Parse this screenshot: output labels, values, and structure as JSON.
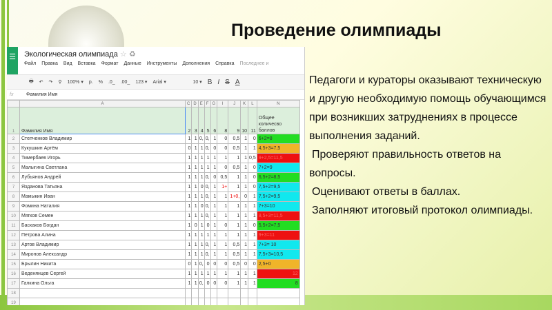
{
  "slide": {
    "title": "Проведение олимпиады",
    "paragraphs": [
      "Педагоги и кураторы оказывают техническую и другую необходимую помощь обучающимся при возникших затруднениях в процессе выполнения заданий.",
      "Проверяют правильность ответов на вопросы.",
      "Оценивают ответы в баллах.",
      "Заполняют итоговый протокол олимпиады."
    ]
  },
  "sheet": {
    "title": "Экологическая олимпиада",
    "menu": [
      "Файл",
      "Правка",
      "Вид",
      "Вставка",
      "Формат",
      "Данные",
      "Инструменты",
      "Дополнения",
      "Справка",
      "Последнее и"
    ],
    "toolbar": {
      "zoom": "100% ▾",
      "currency": "р.",
      "percent": "%",
      "dec1": ".0_",
      "dec2": ".00_",
      "format": "123 ▾",
      "font": "Arial ▾",
      "size": "10 ▾",
      "bold": "B",
      "italic": "I",
      "strike": "S",
      "color": "A"
    },
    "formula": {
      "fx": "fx",
      "value": "Фамилия Имя"
    },
    "columns": [
      "",
      "A",
      "C",
      "D",
      "E",
      "F",
      "G",
      "I",
      "J",
      "K",
      "L",
      "N"
    ],
    "header_row": [
      "1",
      "Фамилия Имя",
      "2",
      "3",
      "4",
      "5",
      "6",
      "8",
      "9",
      "10",
      "11",
      "Общее количесво баллов"
    ],
    "rows": [
      [
        "2",
        "Степченков Владимир",
        "1",
        "1",
        "0,",
        "0,",
        "1",
        "0",
        "0,5",
        "1",
        "0",
        "6+2=8",
        "#22dd22"
      ],
      [
        "3",
        "Кукушкин Артём",
        "0",
        "1",
        "1",
        "0,",
        "0",
        "0",
        "0,5",
        "1",
        "1",
        "4,5+3=7,5",
        "#f0b429"
      ],
      [
        "4",
        "Тимербаев Игорь",
        "1",
        "1",
        "1",
        "1",
        "1",
        "1",
        "1",
        "1",
        "0,5",
        "9+2,5=11,5",
        "#ee1111"
      ],
      [
        "5",
        "Малыгина Светлана",
        "1",
        "1",
        "1",
        "1",
        "1",
        "0",
        "0,5",
        "1",
        "0",
        "7+2=9",
        "#11e8ee"
      ],
      [
        "6",
        "Лубьянов Андрей",
        "1",
        "1",
        "1",
        "0,",
        "0",
        "0,5",
        "1",
        "1",
        "0",
        "6,5+2=8,5",
        "#22dd22"
      ],
      [
        "7",
        "Язданова Татьяна",
        "1",
        "1",
        "0",
        "0,",
        "1",
        "1+",
        "1",
        "1",
        "0",
        "7,5+2=9,5",
        "#11e8ee"
      ],
      [
        "8",
        "Мамыкин Иван",
        "1",
        "1",
        "1",
        "0,",
        "1",
        "1",
        "1+0,",
        "0",
        "1",
        "7,5+2=9,5",
        "#11e8ee"
      ],
      [
        "9",
        "Фомина Наталия",
        "1",
        "1",
        "0",
        "0,",
        "1",
        "1",
        "1",
        "1",
        "1",
        "7+3=10",
        "#11e8ee"
      ],
      [
        "10",
        "Мягков Семен",
        "1",
        "1",
        "1",
        "0,",
        "1",
        "1",
        "1",
        "1",
        "1",
        "8,5+3=11,5",
        "#ee1111"
      ],
      [
        "11",
        "Баскаков Богдан",
        "1",
        "0",
        "1",
        "0",
        "1",
        "0",
        "1",
        "1",
        "0",
        "5,5+2=7,5",
        "#22dd22"
      ],
      [
        "12",
        "Петрова Алина",
        "1",
        "1",
        "1",
        "1",
        "1",
        "1",
        "1",
        "1",
        "1",
        "9+3=11",
        "#ee1111"
      ],
      [
        "13",
        "Артов Владимир",
        "1",
        "1",
        "1",
        "0,",
        "1",
        "1",
        "0,5",
        "1",
        "1",
        "7+3= 10",
        "#11e8ee"
      ],
      [
        "14",
        "Миронов Александр",
        "1",
        "1",
        "1",
        "0,",
        "1",
        "1",
        "0,5",
        "1",
        "1",
        "7,5+3=10,5",
        "#11e8ee"
      ],
      [
        "15",
        "Брылин Никита",
        "0",
        "1",
        "0,",
        "0",
        "0",
        "0",
        "0,5",
        "0",
        "0",
        "2,5+0",
        "#f0b429"
      ],
      [
        "16",
        "Веденянцев Сергей",
        "1",
        "1",
        "1",
        "1",
        "1",
        "1",
        "1",
        "1",
        "1",
        "12",
        "#ee1111"
      ],
      [
        "17",
        "Галкина Ольга",
        "1",
        "1",
        "0,",
        "0",
        "0",
        "0",
        "1",
        "1",
        "1",
        "8",
        "#22dd22"
      ]
    ],
    "empty_rows": [
      "18",
      "19"
    ]
  }
}
